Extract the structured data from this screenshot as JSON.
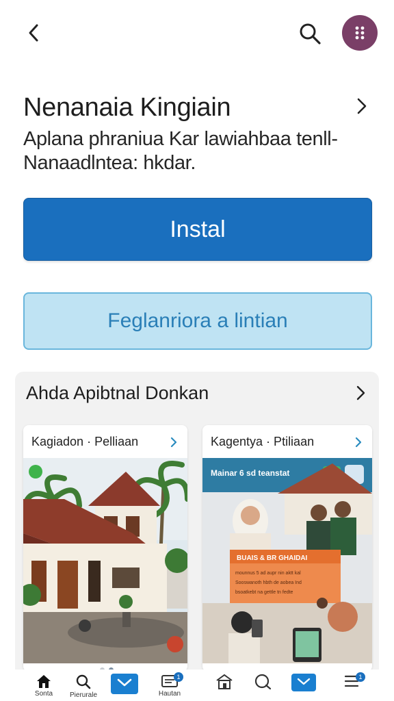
{
  "header": {
    "back_icon": "arrow-back-icon",
    "search_icon": "search-icon",
    "menu_icon": "grid-dots-icon",
    "menu_color": "#7a3f67"
  },
  "app": {
    "title": "Nenanaia Kingiain",
    "description_line1": "Aplana phraniua Kar lawiahbaa tenll-",
    "description_line2": "Nanaadlntea: hkdar."
  },
  "actions": {
    "install_label": "Instal",
    "install_color": "#1a6fbe",
    "secondary_label": "Feglanriora a lintian",
    "secondary_color": "#bfe3f3"
  },
  "section": {
    "title": "Ahda Apibtnal Donkan",
    "cards": [
      {
        "title": "Kagiadon · Pelliaan",
        "image": "house-garden-photo"
      },
      {
        "title": "Kagentya · Ptiliaan",
        "image": "people-phones-collage",
        "overlay_title": "Mainar 6 sd teanstat",
        "panel_title": "BUAIS & BR GHAIDAI",
        "panel_line1": "mounnus 5 ad aupr nin aktt kal",
        "panel_line2": "Sooswanoth hbth de aobea Ind",
        "panel_line3": "bsoatkebt na gettle tn fedte"
      }
    ],
    "pager_total": 2,
    "pager_active": 1
  },
  "bottom_nav": {
    "items": [
      {
        "label": "Sonta",
        "icon": "home-icon"
      },
      {
        "label": "Pierurale",
        "icon": "search-icon"
      },
      {
        "label": "",
        "icon": "mail-icon"
      },
      {
        "label": "Hautan",
        "icon": "inbox-icon",
        "badge": "1"
      },
      {
        "label": "",
        "icon": "store-icon"
      },
      {
        "label": "",
        "icon": "chat-icon"
      },
      {
        "label": "",
        "icon": "mail-icon"
      },
      {
        "label": "",
        "icon": "menu-icon",
        "badge": "1"
      }
    ]
  }
}
